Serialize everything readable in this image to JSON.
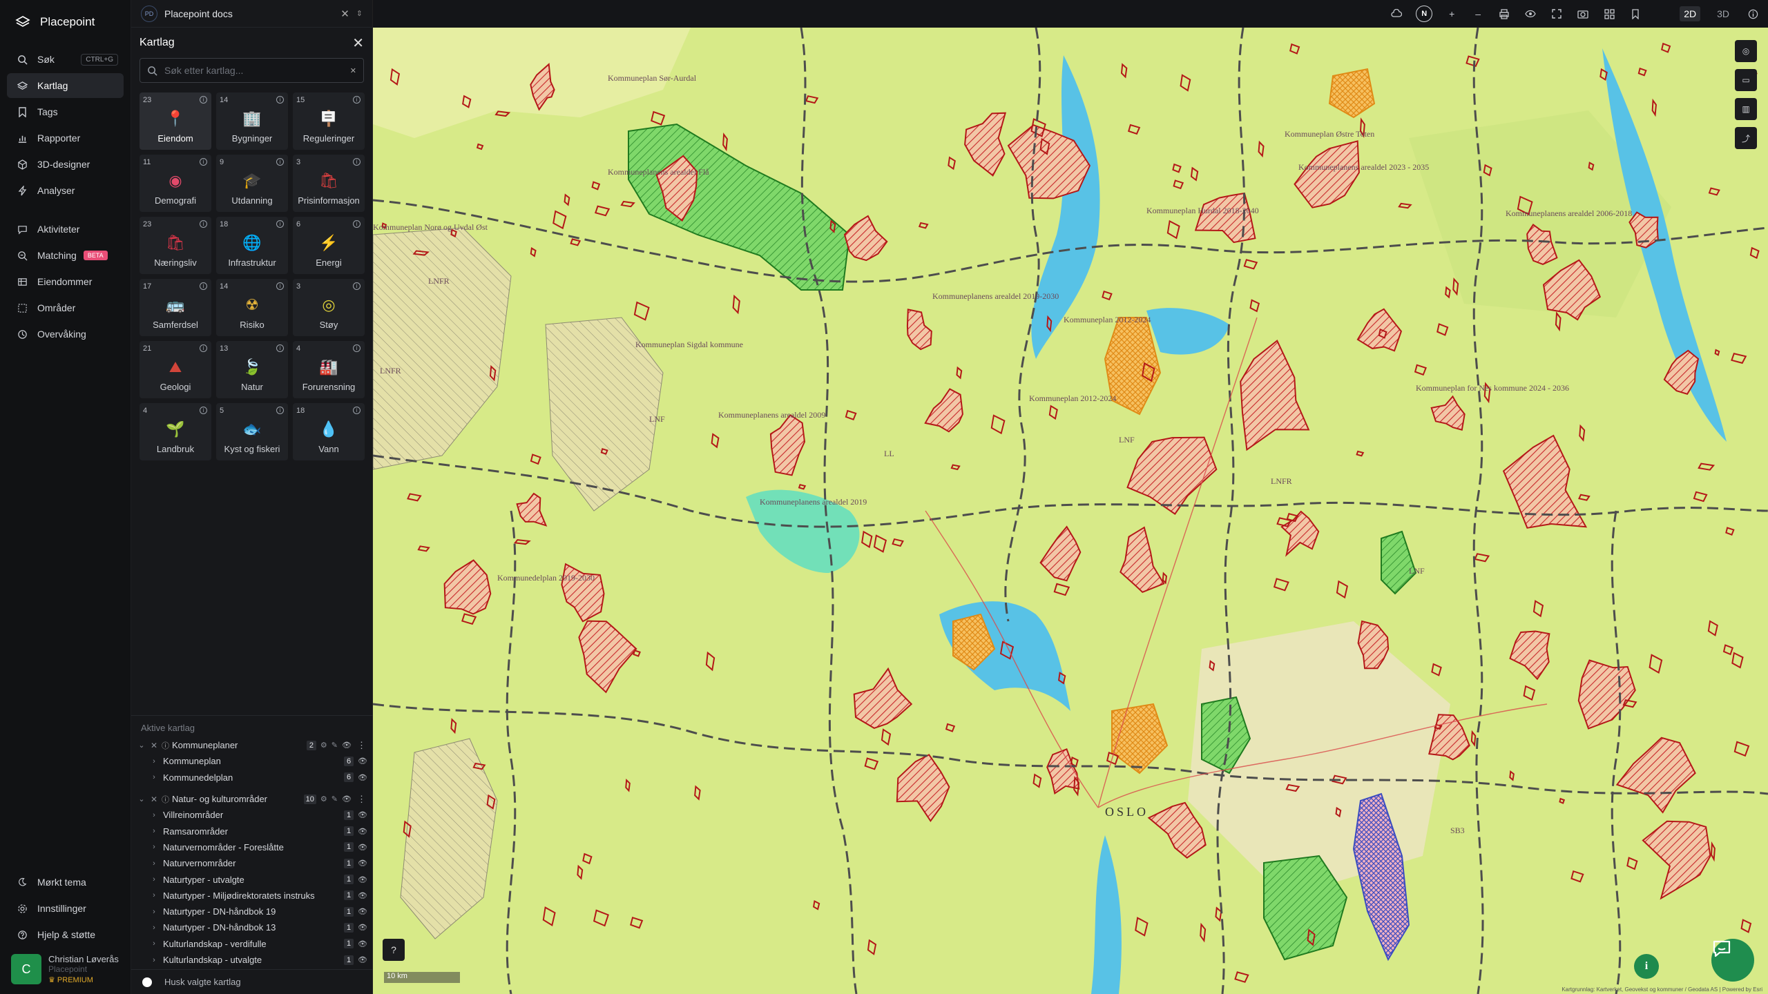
{
  "app": {
    "name": "Placepoint"
  },
  "nav": {
    "search_label": "Søk",
    "search_shortcut": "CTRL+G",
    "items": [
      {
        "label": "Kartlag",
        "icon": "layers-icon"
      },
      {
        "label": "Tags",
        "icon": "bookmark-icon"
      },
      {
        "label": "Rapporter",
        "icon": "chart-icon"
      },
      {
        "label": "3D-designer",
        "icon": "cube-icon"
      },
      {
        "label": "Analyser",
        "icon": "bolt-icon"
      }
    ],
    "items2": [
      {
        "label": "Aktiviteter",
        "icon": "chat-icon"
      },
      {
        "label": "Matching",
        "icon": "match-icon",
        "badge": "BETA"
      },
      {
        "label": "Eiendommer",
        "icon": "table-icon"
      },
      {
        "label": "Områder",
        "icon": "area-icon"
      },
      {
        "label": "Overvåking",
        "icon": "clock-icon"
      }
    ],
    "bottom": [
      {
        "label": "Mørkt tema",
        "icon": "moon-icon"
      },
      {
        "label": "Innstillinger",
        "icon": "gear-icon"
      },
      {
        "label": "Hjelp & støtte",
        "icon": "help-icon"
      }
    ],
    "user": {
      "initial": "C",
      "name": "Christian Løverås",
      "org": "Placepoint",
      "plan": "PREMIUM"
    }
  },
  "panel": {
    "doc_badge": "PD",
    "doc_title": "Placepoint docs",
    "title": "Kartlag",
    "search_placeholder": "Søk etter kartlag...",
    "categories": [
      {
        "count": "23",
        "label": "Eiendom",
        "icon": "pin-icon",
        "color": "#e23b3b",
        "active": true
      },
      {
        "count": "14",
        "label": "Bygninger",
        "icon": "building-icon",
        "color": "#8fa6c9"
      },
      {
        "count": "15",
        "label": "Reguleringer",
        "icon": "signpost-icon",
        "color": "#e3a23a"
      },
      {
        "count": "11",
        "label": "Demografi",
        "icon": "people-icon",
        "color": "#e24a6a"
      },
      {
        "count": "9",
        "label": "Utdanning",
        "icon": "grad-cap-icon",
        "color": "#3b5fc0"
      },
      {
        "count": "3",
        "label": "Prisinformasjon",
        "icon": "price-bag-icon",
        "color": "#e04040"
      },
      {
        "count": "23",
        "label": "Næringsliv",
        "icon": "shop-bag-icon",
        "color": "#e0364a"
      },
      {
        "count": "18",
        "label": "Infrastruktur",
        "icon": "globe-icon",
        "color": "#8b6be0"
      },
      {
        "count": "6",
        "label": "Energi",
        "icon": "lightning-icon",
        "color": "#f3c21c"
      },
      {
        "count": "17",
        "label": "Samferdsel",
        "icon": "bus-icon",
        "color": "#d8d8d8"
      },
      {
        "count": "14",
        "label": "Risiko",
        "icon": "hazard-icon",
        "color": "#e2b23a"
      },
      {
        "count": "3",
        "label": "Støy",
        "icon": "noise-icon",
        "color": "#e0d23a"
      },
      {
        "count": "21",
        "label": "Geologi",
        "icon": "mountain-icon",
        "color": "#d2453a"
      },
      {
        "count": "13",
        "label": "Natur",
        "icon": "leaf-icon",
        "color": "#3dbd5a"
      },
      {
        "count": "4",
        "label": "Forurensning",
        "icon": "factory-icon",
        "color": "#9bb3d8"
      },
      {
        "count": "4",
        "label": "Landbruk",
        "icon": "sprout-icon",
        "color": "#3cb45a"
      },
      {
        "count": "5",
        "label": "Kyst og fiskeri",
        "icon": "fish-icon",
        "color": "#f0a030"
      },
      {
        "count": "18",
        "label": "Vann",
        "icon": "drop-icon",
        "color": "#3aa0e8"
      }
    ],
    "active_title": "Aktive kartlag",
    "groups": [
      {
        "name": "Kommuneplaner",
        "count": "2",
        "layers": [
          {
            "name": "Kommuneplan",
            "count": "6"
          },
          {
            "name": "Kommunedelplan",
            "count": "6"
          }
        ]
      },
      {
        "name": "Natur- og kulturområder",
        "count": "10",
        "layers": [
          {
            "name": "Villreinområder",
            "count": "1"
          },
          {
            "name": "Ramsarområder",
            "count": "1"
          },
          {
            "name": "Naturvernområder - Foreslåtte",
            "count": "1"
          },
          {
            "name": "Naturvernområder",
            "count": "1"
          },
          {
            "name": "Naturtyper - utvalgte",
            "count": "1"
          },
          {
            "name": "Naturtyper - Miljødirektoratets instruks",
            "count": "1"
          },
          {
            "name": "Naturtyper - DN-håndbok 19",
            "count": "1"
          },
          {
            "name": "Naturtyper - DN-håndbok 13",
            "count": "1"
          },
          {
            "name": "Kulturlandskap - verdifulle",
            "count": "1"
          },
          {
            "name": "Kulturlandskap - utvalgte",
            "count": "1"
          }
        ]
      }
    ],
    "remember_label": "Husk valgte kartlag"
  },
  "toolbar": {
    "compass": "N",
    "mode_2d": "2D",
    "mode_3d": "3D",
    "zoom_in": "+",
    "zoom_out": "–"
  },
  "map": {
    "scale": "10 km",
    "attribution": "Kartgrunnlag: Kartverket, Geovekst og kommuner / Geodata AS | Powered by Esri",
    "labels": [
      "Kommuneplanens arealdel 2023 - 2035",
      "Kommuneplanens arealdel 2006-2018",
      "Kommuneplanens arealdel 2019-2030",
      "Kommuneplan 2012-2024",
      "Kommuneplan Sigdal kommune",
      "Kommuneplan Sør-Aurdal",
      "Kommuneplanens arealdel Flå",
      "Kommuneplan Norø og Uvdal Øst",
      "Kommuneplanens arealdel 2009",
      "Kommuneplanens arealdel 2019",
      "Kommuneplan for Nes kommune 2024 - 2036",
      "Kommuneplan Østre Toten",
      "Kommuneplan Hurdal 2018-2040",
      "Kommuneplan 2012-2024",
      "Kommunedelplan 2019-2030",
      "LNFR",
      "LNFR",
      "LNF",
      "LNF",
      "LL",
      "SB3",
      "OSLO",
      "LNFR",
      "LNF"
    ]
  }
}
